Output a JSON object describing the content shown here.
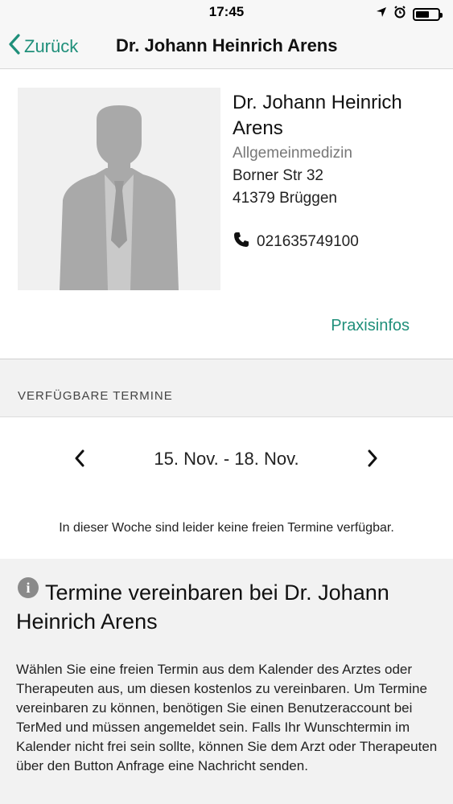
{
  "status_bar": {
    "time": "17:45"
  },
  "nav": {
    "back_label": "Zurück",
    "title": "Dr. Johann Heinrich Arens"
  },
  "doctor": {
    "name": "Dr. Johann Heinrich Arens",
    "specialty": "Allgemeinmedizin",
    "street": "Borner Str 32",
    "city": "41379 Brüggen",
    "phone": "021635749100",
    "praxis_link": "Praxisinfos"
  },
  "appointments": {
    "section_title": "VERFÜGBARE TERMINE",
    "week_range": "15. Nov. - 18. Nov.",
    "no_slots_message": "In dieser Woche sind leider keine freien Termine verfügbar."
  },
  "info": {
    "heading": "Termine vereinbaren bei Dr. Johann Heinrich Arens",
    "body": "Wählen Sie eine freien Termin aus dem Kalender des Arztes oder Therapeuten aus, um diesen kostenlos zu vereinbaren. Um Termine vereinbaren zu können, benötigen Sie einen Benutzeraccount bei TerMed und müssen angemeldet sein. Falls Ihr Wunschtermin im Kalender nicht frei sein sollte, können Sie dem Arzt oder Therapeuten über den Button Anfrage eine Nachricht senden."
  },
  "colors": {
    "accent": "#1f8f7a",
    "section_bg": "#f2f2f2",
    "bar_bg": "#f7f7f7"
  },
  "icons": [
    "location-arrow-icon",
    "alarm-clock-icon",
    "battery-icon",
    "chevron-left-icon",
    "phone-icon",
    "chevron-right-icon",
    "info-icon",
    "avatar-placeholder"
  ]
}
